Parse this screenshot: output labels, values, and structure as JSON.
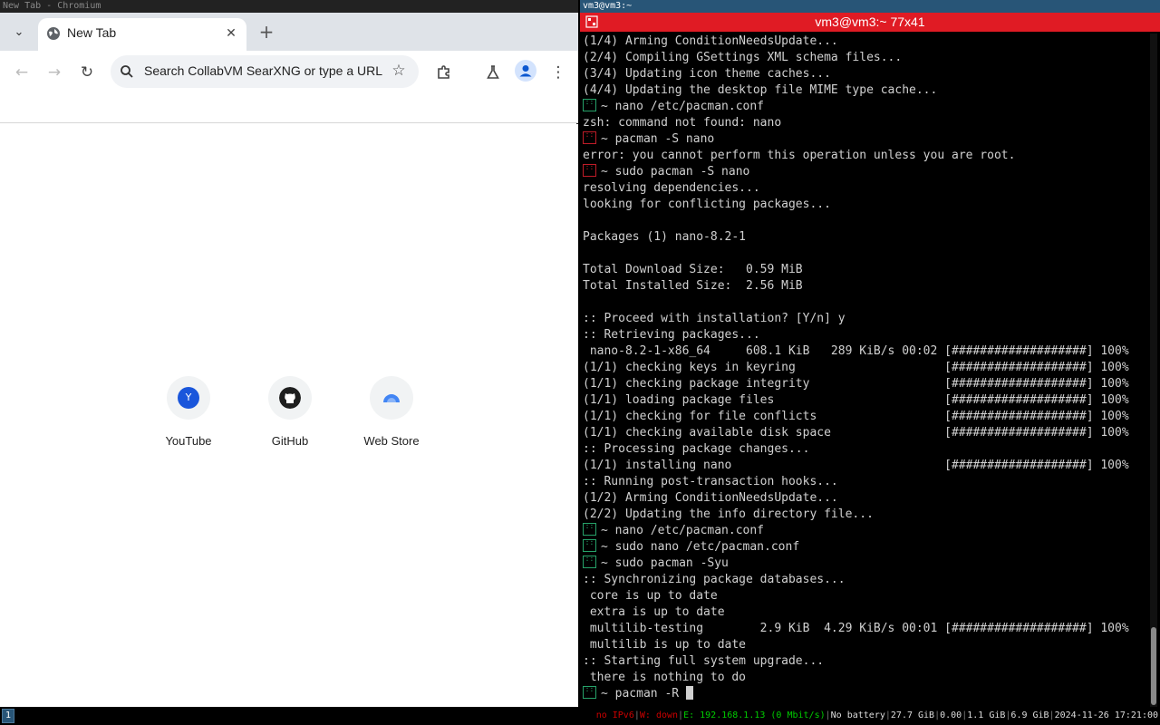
{
  "left_window_title": "New Tab - Chromium",
  "right_window_title": "vm3@vm3:~",
  "browser": {
    "tab_title": "New Tab",
    "omnibox_placeholder": "Search CollabVM SearXNG or type a URL",
    "shortcuts": [
      {
        "label": "YouTube",
        "letter": "Y",
        "color": "#1a56db"
      },
      {
        "label": "GitHub",
        "letter": "",
        "color": "#1f1f1f"
      },
      {
        "label": "Web Store",
        "letter": "",
        "color": "#4285f4"
      }
    ]
  },
  "terminal": {
    "title": "vm3@vm3:~ 77x41",
    "lines": [
      {
        "text": "(1/4) Arming ConditionNeedsUpdate..."
      },
      {
        "text": "(2/4) Compiling GSettings XML schema files..."
      },
      {
        "text": "(3/4) Updating icon theme caches..."
      },
      {
        "text": "(4/4) Updating the desktop file MIME type cache..."
      },
      {
        "prompt": "ok",
        "text": "~ nano /etc/pacman.conf"
      },
      {
        "text": "zsh: command not found: nano"
      },
      {
        "prompt": "err",
        "text": "~ pacman -S nano"
      },
      {
        "text": "error: you cannot perform this operation unless you are root."
      },
      {
        "prompt": "err",
        "text": "~ sudo pacman -S nano"
      },
      {
        "text": "resolving dependencies..."
      },
      {
        "text": "looking for conflicting packages..."
      },
      {
        "text": ""
      },
      {
        "text": "Packages (1) nano-8.2-1"
      },
      {
        "text": ""
      },
      {
        "text": "Total Download Size:   0.59 MiB"
      },
      {
        "text": "Total Installed Size:  2.56 MiB"
      },
      {
        "text": ""
      },
      {
        "text": ":: Proceed with installation? [Y/n] y"
      },
      {
        "text": ":: Retrieving packages..."
      },
      {
        "text": " nano-8.2-1-x86_64     608.1 KiB   289 KiB/s 00:02 [###################] 100%"
      },
      {
        "text": "(1/1) checking keys in keyring                     [###################] 100%"
      },
      {
        "text": "(1/1) checking package integrity                   [###################] 100%"
      },
      {
        "text": "(1/1) loading package files                        [###################] 100%"
      },
      {
        "text": "(1/1) checking for file conflicts                  [###################] 100%"
      },
      {
        "text": "(1/1) checking available disk space                [###################] 100%"
      },
      {
        "text": ":: Processing package changes..."
      },
      {
        "text": "(1/1) installing nano                              [###################] 100%"
      },
      {
        "text": ":: Running post-transaction hooks..."
      },
      {
        "text": "(1/2) Arming ConditionNeedsUpdate..."
      },
      {
        "text": "(2/2) Updating the info directory file..."
      },
      {
        "prompt": "ok",
        "text": "~ nano /etc/pacman.conf"
      },
      {
        "prompt": "ok",
        "text": "~ sudo nano /etc/pacman.conf"
      },
      {
        "prompt": "ok",
        "text": "~ sudo pacman -Syu"
      },
      {
        "text": ":: Synchronizing package databases..."
      },
      {
        "text": " core is up to date"
      },
      {
        "text": " extra is up to date"
      },
      {
        "text": " multilib-testing        2.9 KiB  4.29 KiB/s 00:01 [###################] 100%"
      },
      {
        "text": " multilib is up to date"
      },
      {
        "text": ":: Starting full system upgrade..."
      },
      {
        "text": " there is nothing to do"
      },
      {
        "prompt": "ok",
        "text": "~ pacman -R ",
        "cursor": true
      }
    ]
  },
  "statusbar": {
    "workspace": "1",
    "items": [
      {
        "text": "no IPv6",
        "color": "#cc0000"
      },
      {
        "text": "W: down",
        "color": "#cc0000"
      },
      {
        "text": "E: 192.168.1.13 (0 Mbit/s)",
        "color": "#00cc00"
      },
      {
        "text": "No battery",
        "color": "#dddddd"
      },
      {
        "text": "27.7 GiB",
        "color": "#dddddd"
      },
      {
        "text": "0.00",
        "color": "#dddddd"
      },
      {
        "text": "1.1 GiB",
        "color": "#dddddd"
      },
      {
        "text": "6.9 GiB",
        "color": "#dddddd"
      },
      {
        "text": "2024-11-26 17:21:00",
        "color": "#dddddd"
      }
    ]
  }
}
